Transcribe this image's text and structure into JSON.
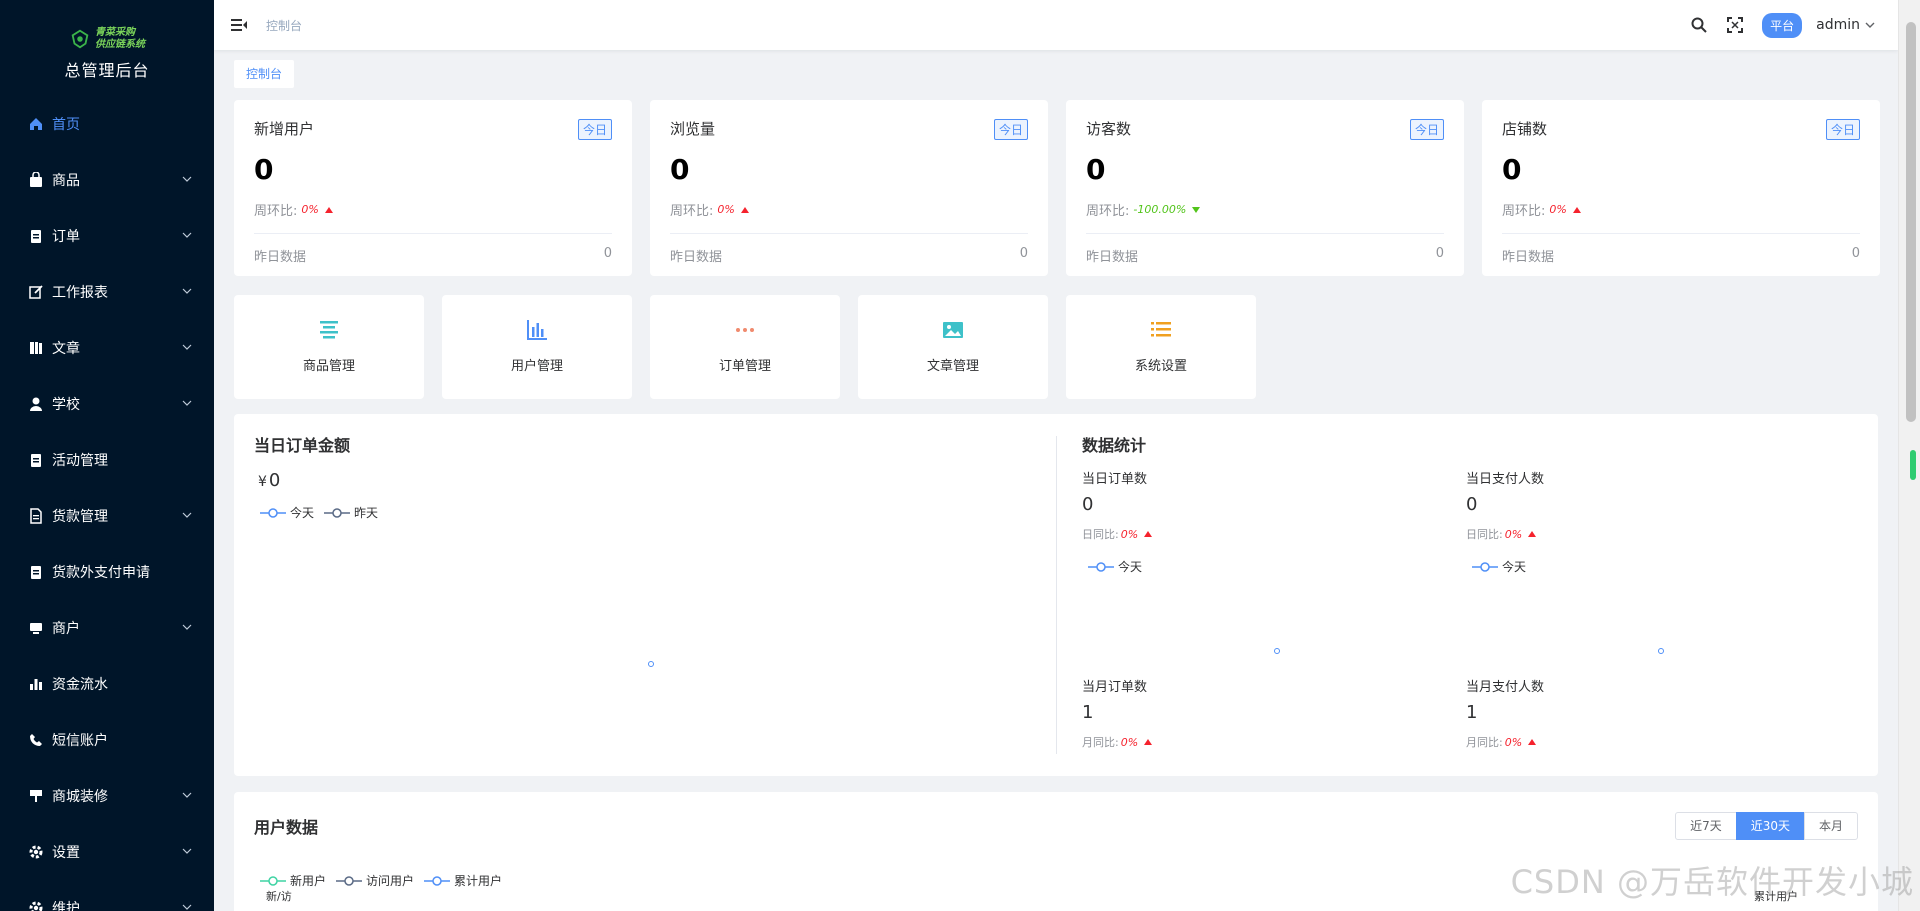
{
  "sidebar": {
    "logo_line1": "青菜采购",
    "logo_line2": "供应链系统",
    "title": "总管理后台",
    "items": [
      {
        "label": "首页",
        "icon": "home-icon",
        "active": true,
        "has_arrow": false
      },
      {
        "label": "商品",
        "icon": "bag-icon",
        "active": false,
        "has_arrow": true
      },
      {
        "label": "订单",
        "icon": "clipboard-icon",
        "active": false,
        "has_arrow": true
      },
      {
        "label": "工作报表",
        "icon": "edit-icon",
        "active": false,
        "has_arrow": true
      },
      {
        "label": "文章",
        "icon": "book-icon",
        "active": false,
        "has_arrow": true
      },
      {
        "label": "学校",
        "icon": "user-icon",
        "active": false,
        "has_arrow": true
      },
      {
        "label": "活动管理",
        "icon": "clipboard-icon",
        "active": false,
        "has_arrow": false
      },
      {
        "label": "货款管理",
        "icon": "document-icon",
        "active": false,
        "has_arrow": true
      },
      {
        "label": "货款外支付申请",
        "icon": "clipboard-icon",
        "active": false,
        "has_arrow": false
      },
      {
        "label": "商户",
        "icon": "monitor-icon",
        "active": false,
        "has_arrow": true
      },
      {
        "label": "资金流水",
        "icon": "bar-chart-icon",
        "active": false,
        "has_arrow": false
      },
      {
        "label": "短信账户",
        "icon": "phone-icon",
        "active": false,
        "has_arrow": false
      },
      {
        "label": "商城装修",
        "icon": "brush-icon",
        "active": false,
        "has_arrow": true
      },
      {
        "label": "设置",
        "icon": "gear-icon",
        "active": false,
        "has_arrow": true
      },
      {
        "label": "维护",
        "icon": "gear-icon",
        "active": false,
        "has_arrow": true
      }
    ]
  },
  "header": {
    "breadcrumb": "控制台",
    "platform_badge": "平台",
    "user": "admin"
  },
  "tag": "控制台",
  "stats": [
    {
      "title": "新增用户",
      "badge": "今日",
      "value": "0",
      "ratio_label": "周环比:",
      "ratio": "0%",
      "trend": "up",
      "foot_label": "昨日数据",
      "foot_value": "0"
    },
    {
      "title": "浏览量",
      "badge": "今日",
      "value": "0",
      "ratio_label": "周环比:",
      "ratio": "0%",
      "trend": "up",
      "foot_label": "昨日数据",
      "foot_value": "0"
    },
    {
      "title": "访客数",
      "badge": "今日",
      "value": "0",
      "ratio_label": "周环比:",
      "ratio": "-100.00%",
      "trend": "down",
      "foot_label": "昨日数据",
      "foot_value": "0"
    },
    {
      "title": "店铺数",
      "badge": "今日",
      "value": "0",
      "ratio_label": "周环比:",
      "ratio": "0%",
      "trend": "up",
      "foot_label": "昨日数据",
      "foot_value": "0"
    }
  ],
  "shortcuts": [
    {
      "label": "商品管理",
      "icon": "list-lines-icon",
      "color": "#3ec1c9"
    },
    {
      "label": "用户管理",
      "icon": "bar-chart-icon",
      "color": "#4f8ff7"
    },
    {
      "label": "订单管理",
      "icon": "ellipsis-icon",
      "color": "#f08a6e"
    },
    {
      "label": "文章管理",
      "icon": "image-icon",
      "color": "#3ec1c9"
    },
    {
      "label": "系统设置",
      "icon": "list-icon",
      "color": "#f0a020"
    }
  ],
  "order_amount": {
    "title": "当日订单金额",
    "currency": "¥",
    "amount": "0",
    "legend": [
      "今天",
      "昨天"
    ]
  },
  "data_stats": {
    "title": "数据统计",
    "blocks": [
      {
        "label": "当日订单数",
        "value": "0",
        "ratio_label": "日同比:",
        "ratio": "0%",
        "legend": "今天"
      },
      {
        "label": "当日支付人数",
        "value": "0",
        "ratio_label": "日同比:",
        "ratio": "0%",
        "legend": "今天"
      },
      {
        "label": "当月订单数",
        "value": "1",
        "ratio_label": "月同比:",
        "ratio": "0%"
      },
      {
        "label": "当月支付人数",
        "value": "1",
        "ratio_label": "月同比:",
        "ratio": "0%"
      }
    ]
  },
  "user_data": {
    "title": "用户数据",
    "ranges": [
      "近7天",
      "近30天",
      "本月"
    ],
    "active_range": "近30天",
    "legend": [
      "新用户",
      "访问用户",
      "累计用户"
    ],
    "axis_left": "新/访",
    "axis_right": "累计用户"
  },
  "watermark": "CSDN @万岳软件开发小城",
  "colors": {
    "sidebar_bg": "#001529",
    "accent": "#4f8ff7",
    "up": "#f5222d",
    "down": "#52c41a"
  }
}
